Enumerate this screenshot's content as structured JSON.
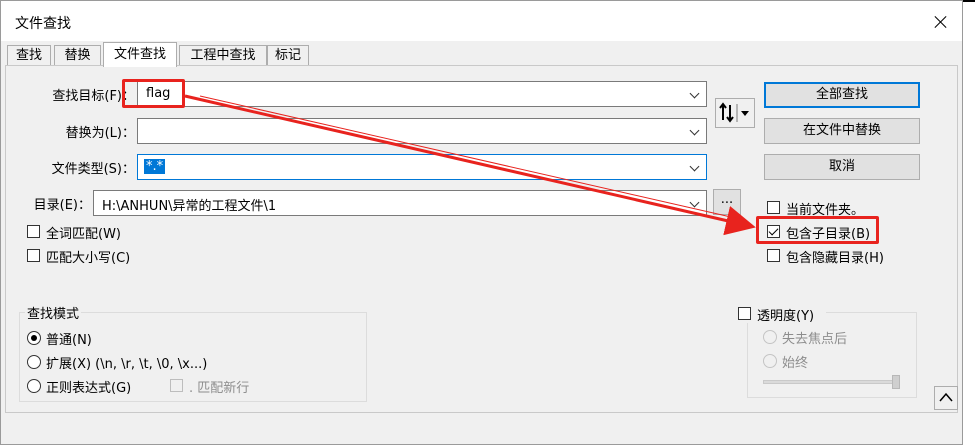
{
  "window": {
    "title": "文件查找"
  },
  "tabs": [
    {
      "label": "查找"
    },
    {
      "label": "替换"
    },
    {
      "label": "文件查找"
    },
    {
      "label": "工程中查找"
    },
    {
      "label": "标记"
    }
  ],
  "fields": {
    "find_label": "查找目标(F)：",
    "find_value": "flag",
    "replace_label": "替换为(L)：",
    "replace_value": "",
    "filetype_label": "文件类型(S)：",
    "filetype_value": "*.*",
    "dir_label": "目录(E)：",
    "dir_value": "H:\\ANHUN\\异常的工程文件\\1",
    "browse_label": "..."
  },
  "options": {
    "whole_word": "全词匹配(W)",
    "match_case": "匹配大小写(C)"
  },
  "buttons": {
    "find_all": "全部查找",
    "replace_in_files": "在文件中替换",
    "cancel": "取消",
    "swap_icon": "swap-icon",
    "collapse": "^"
  },
  "folder_options": {
    "current_folder": {
      "label": "当前文件夹。",
      "checked": false
    },
    "include_subdirs": {
      "label": "包含子目录(B)",
      "checked": true
    },
    "include_hidden": {
      "label": "包含隐藏目录(H)",
      "checked": false
    }
  },
  "search_mode": {
    "title": "查找模式",
    "normal": "普通(N)",
    "extended": "扩展(X) (\\n, \\r, \\t, \\0, \\x...)",
    "regex": "正则表达式(G)",
    "match_newline": ". 匹配新行",
    "selected": "normal"
  },
  "transparency": {
    "label": "透明度(Y)",
    "on_lose_focus": "失去焦点后",
    "always": "始终"
  },
  "annotation": {
    "color": "#e8231e"
  }
}
